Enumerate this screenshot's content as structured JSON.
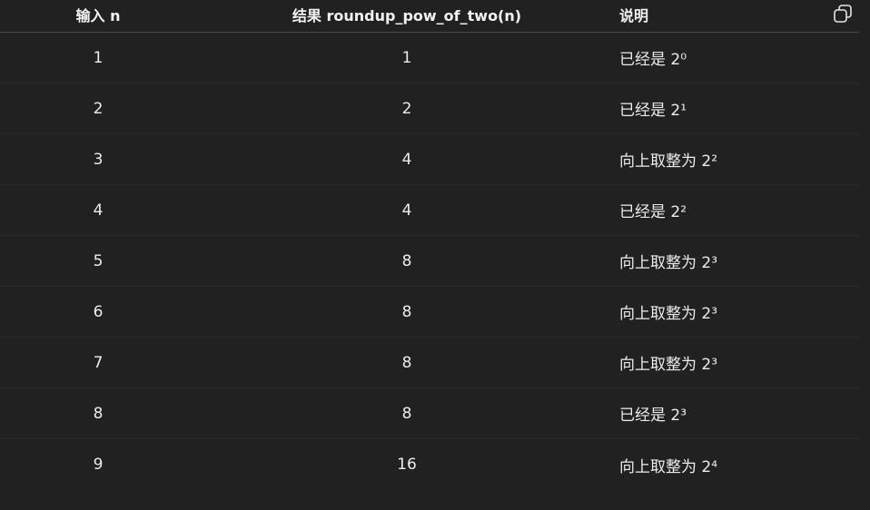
{
  "table": {
    "headers": {
      "n": "输入 n",
      "result": "结果 roundup_pow_of_two(n)",
      "desc": "说明"
    },
    "rows": [
      {
        "n": "1",
        "result": "1",
        "desc": "已经是 2⁰"
      },
      {
        "n": "2",
        "result": "2",
        "desc": "已经是 2¹"
      },
      {
        "n": "3",
        "result": "4",
        "desc": "向上取整为 2²"
      },
      {
        "n": "4",
        "result": "4",
        "desc": "已经是 2²"
      },
      {
        "n": "5",
        "result": "8",
        "desc": "向上取整为 2³"
      },
      {
        "n": "6",
        "result": "8",
        "desc": "向上取整为 2³"
      },
      {
        "n": "7",
        "result": "8",
        "desc": "向上取整为 2³"
      },
      {
        "n": "8",
        "result": "8",
        "desc": "已经是 2³"
      },
      {
        "n": "9",
        "result": "16",
        "desc": "向上取整为 2⁴"
      }
    ]
  },
  "icons": {
    "copy": "copy-icon"
  }
}
